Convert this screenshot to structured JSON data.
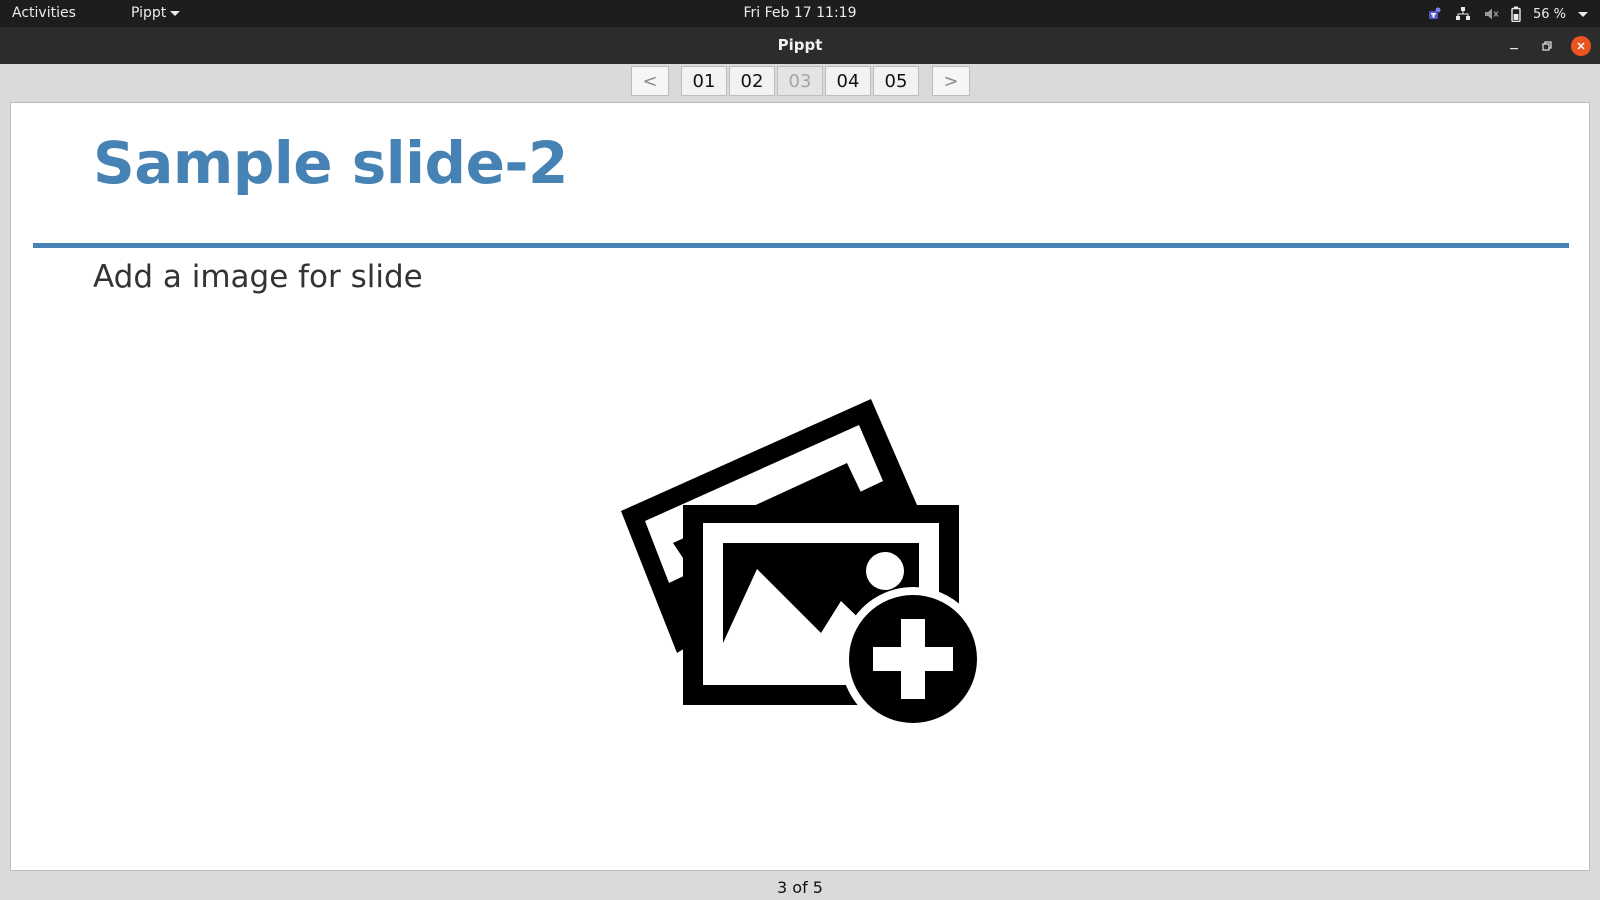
{
  "topbar": {
    "activities": "Activities",
    "app_menu": "Pippt",
    "clock": "Fri Feb 17  11:19",
    "battery": "56 %"
  },
  "window": {
    "title": "Pippt"
  },
  "nav": {
    "prev": "<",
    "next": ">",
    "pages": [
      "01",
      "02",
      "03",
      "04",
      "05"
    ],
    "current_page": "03"
  },
  "slide": {
    "title": "Sample slide-2",
    "subtitle": "Add a image for slide",
    "accent_color": "#4682b4"
  },
  "footer": {
    "status": "3 of 5"
  },
  "icons": {
    "placeholder": "add-image-icon"
  }
}
